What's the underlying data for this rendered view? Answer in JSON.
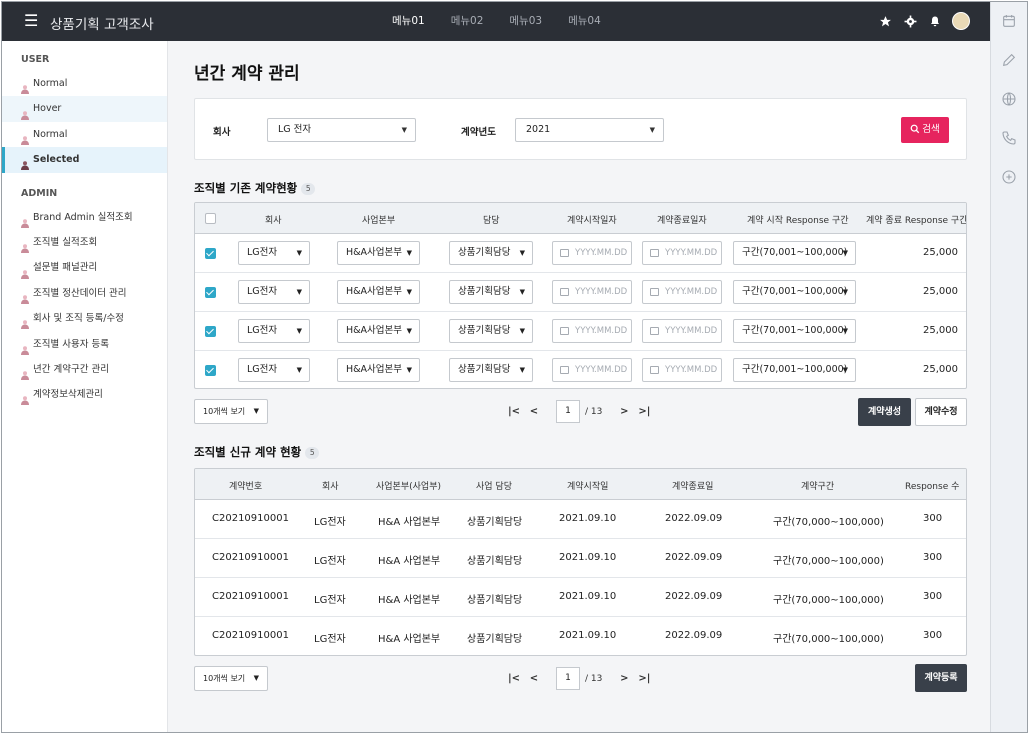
{
  "app": {
    "title": "상품기획 고객조사"
  },
  "nav": [
    "메뉴01",
    "메뉴02",
    "메뉴03",
    "메뉴04"
  ],
  "sidebar": {
    "user_label": "USER",
    "user_items": [
      "Normal",
      "Hover",
      "Normal",
      "Selected"
    ],
    "admin_label": "ADMIN",
    "admin_items": [
      "Brand Admin 실적조회",
      "조직별 실적조회",
      "설문별 패널관리",
      "조직별 정산데이터 관리",
      "회사 및 조직 등록/수정",
      "조직별 사용자 등록",
      "년간 계약구간 관리",
      "계약정보삭제관리"
    ]
  },
  "page": {
    "title": "년간 계약 관리"
  },
  "search": {
    "company_label": "회사",
    "company_value": "LG 전자",
    "year_label": "계약년도",
    "year_value": "2021",
    "button": "검색"
  },
  "table1": {
    "title": "조직별 기존 계약현황",
    "count": "5",
    "headers": [
      "회사",
      "사업본부",
      "담당",
      "계약시작일자",
      "계약종료일자",
      "계약 시작 Response 구간",
      "계약 종료 Response 구간"
    ],
    "rows": [
      {
        "company": "LG전자",
        "division": "H&A사업본부",
        "team": "상품기획담당",
        "start": "YYYY.MM.DD",
        "end": "YYYY.MM.DD",
        "range": "구간(70,001~100,000)",
        "value": "25,000"
      },
      {
        "company": "LG전자",
        "division": "H&A사업본부",
        "team": "상품기획담당",
        "start": "YYYY.MM.DD",
        "end": "YYYY.MM.DD",
        "range": "구간(70,001~100,000)",
        "value": "25,000"
      },
      {
        "company": "LG전자",
        "division": "H&A사업본부",
        "team": "상품기획담당",
        "start": "YYYY.MM.DD",
        "end": "YYYY.MM.DD",
        "range": "구간(70,001~100,000)",
        "value": "25,000"
      },
      {
        "company": "LG전자",
        "division": "H&A사업본부",
        "team": "상품기획담당",
        "start": "YYYY.MM.DD",
        "end": "YYYY.MM.DD",
        "range": "구간(70,001~100,000)",
        "value": "25,000"
      }
    ],
    "pager": {
      "per_page": "10개씩 보기",
      "page": "1",
      "total": "/ 13"
    },
    "btn_create": "계약생성",
    "btn_edit": "계약수정"
  },
  "table2": {
    "title": "조직별 신규 계약 현황",
    "count": "5",
    "headers": [
      "계약번호",
      "회사",
      "사업본부(사업부)",
      "사업 담당",
      "계약시작일",
      "계약종료일",
      "계약구간",
      "Response 수"
    ],
    "rows": [
      [
        "C20210910001",
        "LG전자",
        "H&A 사업본부",
        "상품기획담당",
        "2021.09.10",
        "2022.09.09",
        "구간(70,000~100,000)",
        "300"
      ],
      [
        "C20210910001",
        "LG전자",
        "H&A 사업본부",
        "상품기획담당",
        "2021.09.10",
        "2022.09.09",
        "구간(70,000~100,000)",
        "300"
      ],
      [
        "C20210910001",
        "LG전자",
        "H&A 사업본부",
        "상품기획담당",
        "2021.09.10",
        "2022.09.09",
        "구간(70,000~100,000)",
        "300"
      ],
      [
        "C20210910001",
        "LG전자",
        "H&A 사업본부",
        "상품기획담당",
        "2021.09.10",
        "2022.09.09",
        "구간(70,000~100,000)",
        "300"
      ]
    ],
    "pager": {
      "per_page": "10개씩 보기",
      "page": "1",
      "total": "/ 13"
    },
    "btn_register": "계약등록"
  },
  "colors": {
    "accent": "#e6245e",
    "selected": "#2ea7c8",
    "topbar": "#2b2f36"
  }
}
